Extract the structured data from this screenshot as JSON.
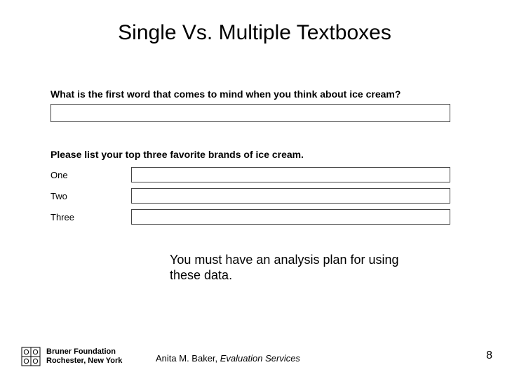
{
  "title": "Single Vs. Multiple Textboxes",
  "question1": {
    "label": "What is the first word that comes to mind when you think about ice cream?"
  },
  "question2": {
    "label": "Please list your top three favorite brands of ice cream.",
    "rows": [
      "One",
      "Two",
      "Three"
    ]
  },
  "note": "You must have an analysis plan for using these data.",
  "footer": {
    "org_name": "Bruner Foundation",
    "org_loc": "Rochester, New York",
    "attr_name": "Anita M. Baker, ",
    "attr_em": "Evaluation Services",
    "page_number": "8"
  }
}
